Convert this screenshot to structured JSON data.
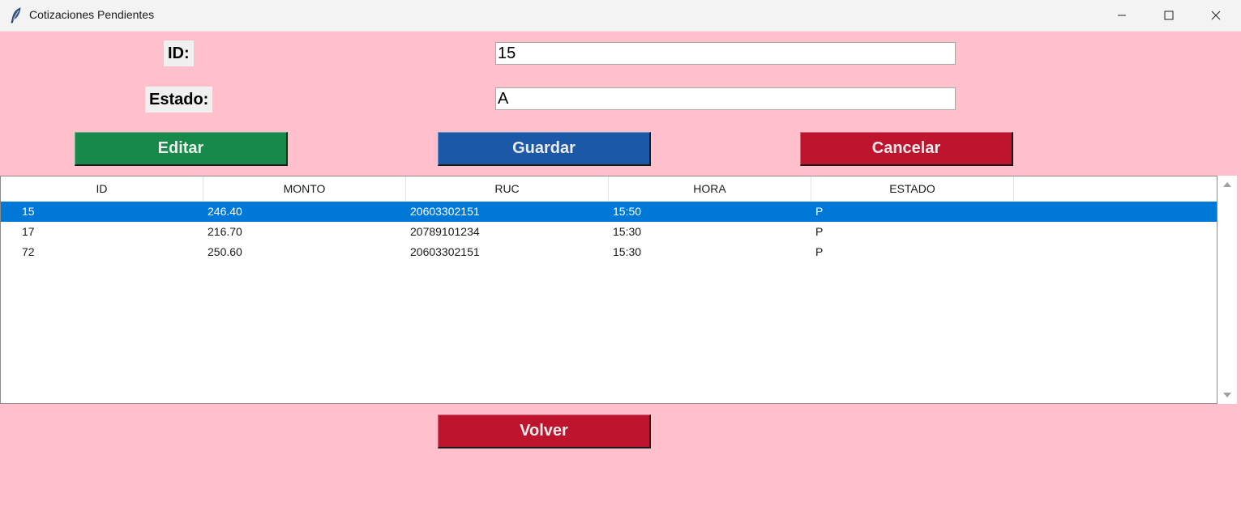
{
  "window": {
    "title": "Cotizaciones Pendientes"
  },
  "form": {
    "id_label": "ID:",
    "id_value": "15",
    "estado_label": "Estado:",
    "estado_value": "A"
  },
  "buttons": {
    "editar": "Editar",
    "guardar": "Guardar",
    "cancelar": "Cancelar",
    "volver": "Volver"
  },
  "table": {
    "columns": [
      "ID",
      "MONTO",
      "RUC",
      "HORA",
      "ESTADO"
    ],
    "rows": [
      [
        "15",
        "246.40",
        "20603302151",
        "15:50",
        "P"
      ],
      [
        "17",
        "216.70",
        "20789101234",
        "15:30",
        "P"
      ],
      [
        "72",
        "250.60",
        "20603302151",
        "15:30",
        "P"
      ]
    ],
    "selected_row": 0
  },
  "colors": {
    "background": "#ffc0cb",
    "editar": "#178a4b",
    "guardar": "#1c58a8",
    "cancelar": "#be142e",
    "selection": "#0078d7"
  }
}
